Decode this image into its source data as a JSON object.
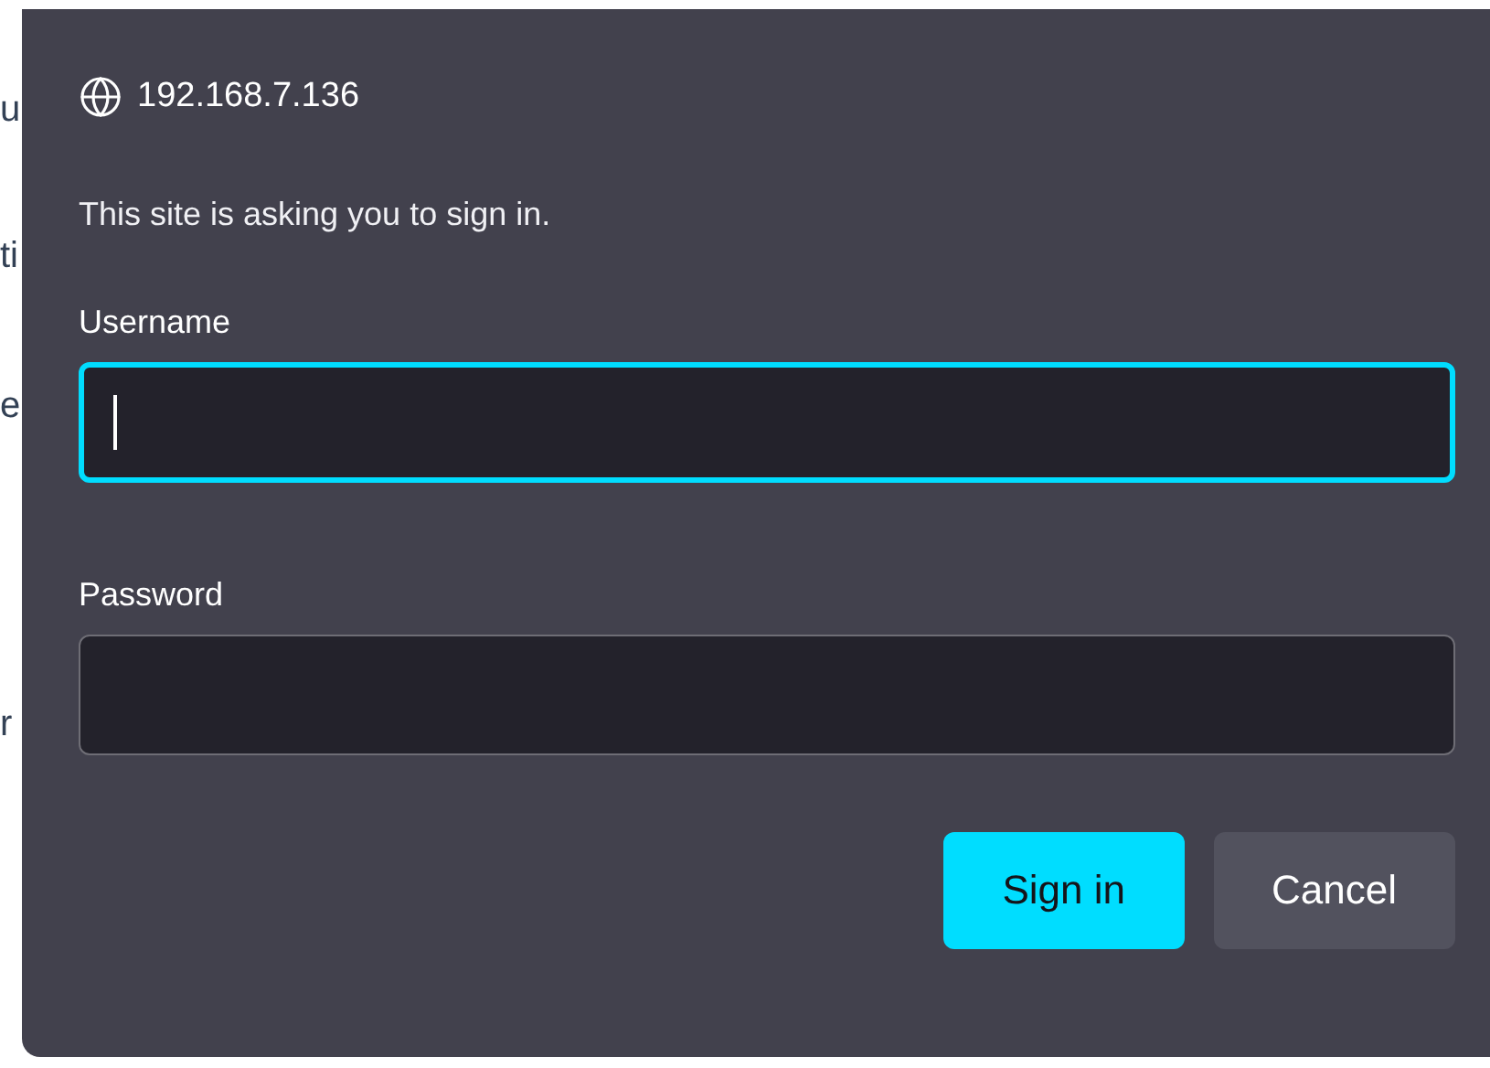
{
  "background_fragments": [
    "u",
    "ti",
    "e",
    "r"
  ],
  "dialog": {
    "site": "192.168.7.136",
    "message": "This site is asking you to sign in.",
    "fields": [
      {
        "label": "Username",
        "focused": true
      },
      {
        "label": "Password",
        "focused": false
      }
    ],
    "buttons": [
      {
        "label": "Sign in",
        "kind": "primary"
      },
      {
        "label": "Cancel",
        "kind": "secondary"
      }
    ]
  }
}
